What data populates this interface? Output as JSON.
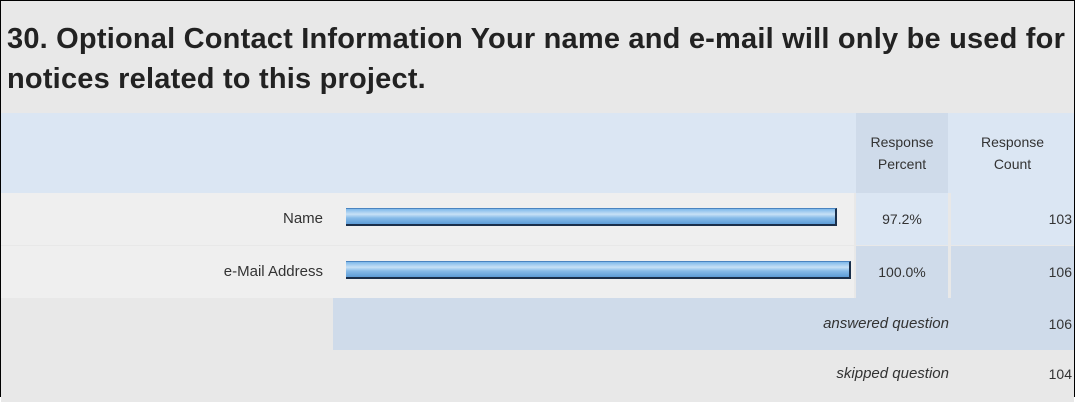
{
  "question": {
    "title": "30. Optional Contact Information Your name and e-mail will only be used for notices related to this project."
  },
  "table": {
    "header_percent_line1": "Response",
    "header_percent_line2": "Percent",
    "header_count_line1": "Response",
    "header_count_line2": "Count",
    "rows": [
      {
        "label": "Name",
        "percent": "97.2%",
        "count": "103",
        "fraction": 0.972
      },
      {
        "label": "e-Mail Address",
        "percent": "100.0%",
        "count": "106",
        "fraction": 1.0
      }
    ]
  },
  "summary": {
    "answered_label": "answered question",
    "answered_value": "106",
    "skipped_label": "skipped question",
    "skipped_value": "104"
  },
  "colors": {
    "header_bg": "#dbe6f3",
    "alt_bg": "#cfdbea",
    "bar": "#86bbe8"
  }
}
